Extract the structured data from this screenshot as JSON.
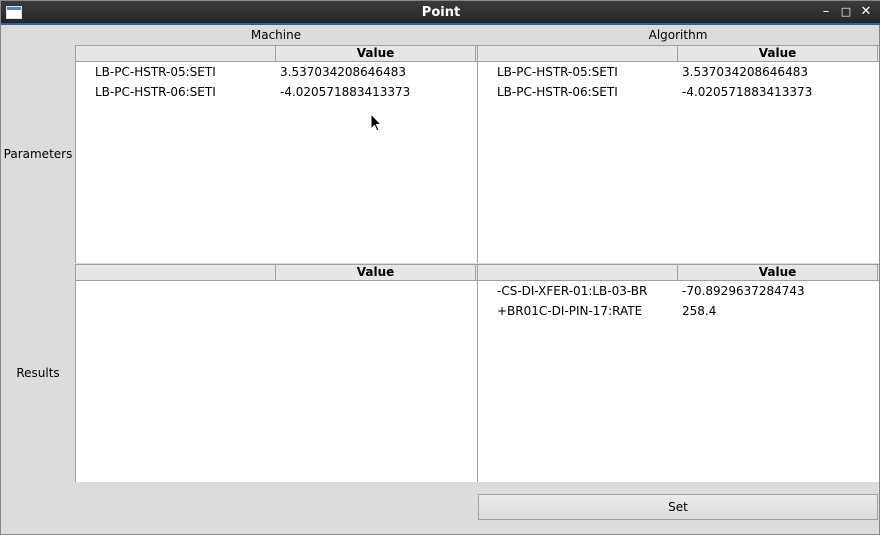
{
  "window": {
    "title": "Point"
  },
  "columns": {
    "machine": "Machine",
    "algorithm": "Algorithm"
  },
  "rows": {
    "parameters": "Parameters",
    "results": "Results"
  },
  "tables": {
    "machine_parameters": {
      "headers": [
        "",
        "Value"
      ],
      "rows": [
        [
          "LB-PC-HSTR-05:SETI",
          "3.537034208646483"
        ],
        [
          "LB-PC-HSTR-06:SETI",
          "-4.020571883413373"
        ]
      ]
    },
    "algorithm_parameters": {
      "headers": [
        "",
        "Value"
      ],
      "rows": [
        [
          "LB-PC-HSTR-05:SETI",
          "3.537034208646483"
        ],
        [
          "LB-PC-HSTR-06:SETI",
          "-4.020571883413373"
        ]
      ]
    },
    "machine_results": {
      "headers": [
        "",
        "Value"
      ],
      "rows": []
    },
    "algorithm_results": {
      "headers": [
        "",
        "Value"
      ],
      "rows": [
        [
          "-CS-DI-XFER-01:LB-03-BR",
          "-70.8929637284743"
        ],
        [
          "+BR01C-DI-PIN-17:RATE",
          "258.4"
        ]
      ]
    }
  },
  "buttons": {
    "set": "Set"
  },
  "icons": {
    "window": "window-icon",
    "minimize": "minimize-icon",
    "maximize": "maximize-icon",
    "close": "close-icon"
  }
}
